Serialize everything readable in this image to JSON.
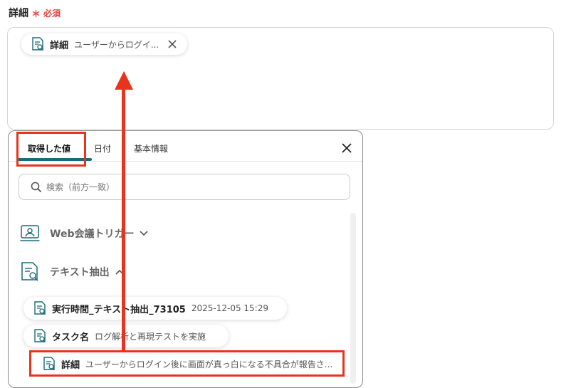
{
  "field": {
    "label": "詳細",
    "required_mark": "＊",
    "required_text": "必須"
  },
  "inserted_chip": {
    "label": "詳細",
    "value": "ユーザーからログイ..."
  },
  "panel": {
    "tabs": [
      {
        "label": "取得した値",
        "active": true
      },
      {
        "label": "日付",
        "active": false
      },
      {
        "label": "基本情報",
        "active": false
      }
    ],
    "search_placeholder": "検索（前方一致）",
    "groups": [
      {
        "label": "Web会議トリガー",
        "expanded": false
      },
      {
        "label": "テキスト抽出",
        "expanded": true
      }
    ],
    "items": [
      {
        "label": "実行時間_テキスト抽出_73105",
        "value": "2025-12-05 15:29"
      },
      {
        "label": "タスク名",
        "value": "ログ解析と再現テストを実施"
      },
      {
        "label": "詳細",
        "value": "ユーザーからログイン後に画面が真っ白になる不具合が報告さ..."
      }
    ]
  },
  "colors": {
    "accent": "#1c6b7a",
    "highlight": "#e8341c",
    "required": "#e8423a"
  }
}
